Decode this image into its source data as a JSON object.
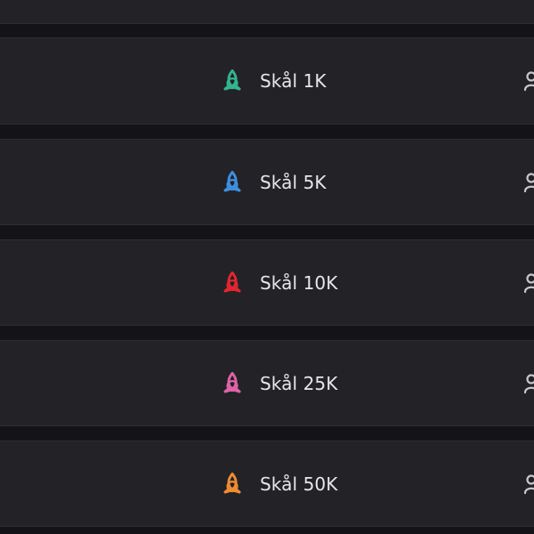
{
  "theme": {
    "background": "#141418",
    "row_background": "#222227",
    "text": "#e7e7eb",
    "icon_muted": "#c8c8cc"
  },
  "rows": [
    {
      "label": "Skål 1K",
      "icon": "triquetra-icon",
      "color": "#32b58e"
    },
    {
      "label": "Skål 5K",
      "icon": "triquetra-icon",
      "color": "#3f8ee0"
    },
    {
      "label": "Skål 10K",
      "icon": "triquetra-icon",
      "color": "#e3262f"
    },
    {
      "label": "Skål 25K",
      "icon": "triquetra-icon",
      "color": "#e063a6"
    },
    {
      "label": "Skål 50K",
      "icon": "triquetra-icon",
      "color": "#ee8d32"
    }
  ],
  "trailing_icon": "user-icon"
}
